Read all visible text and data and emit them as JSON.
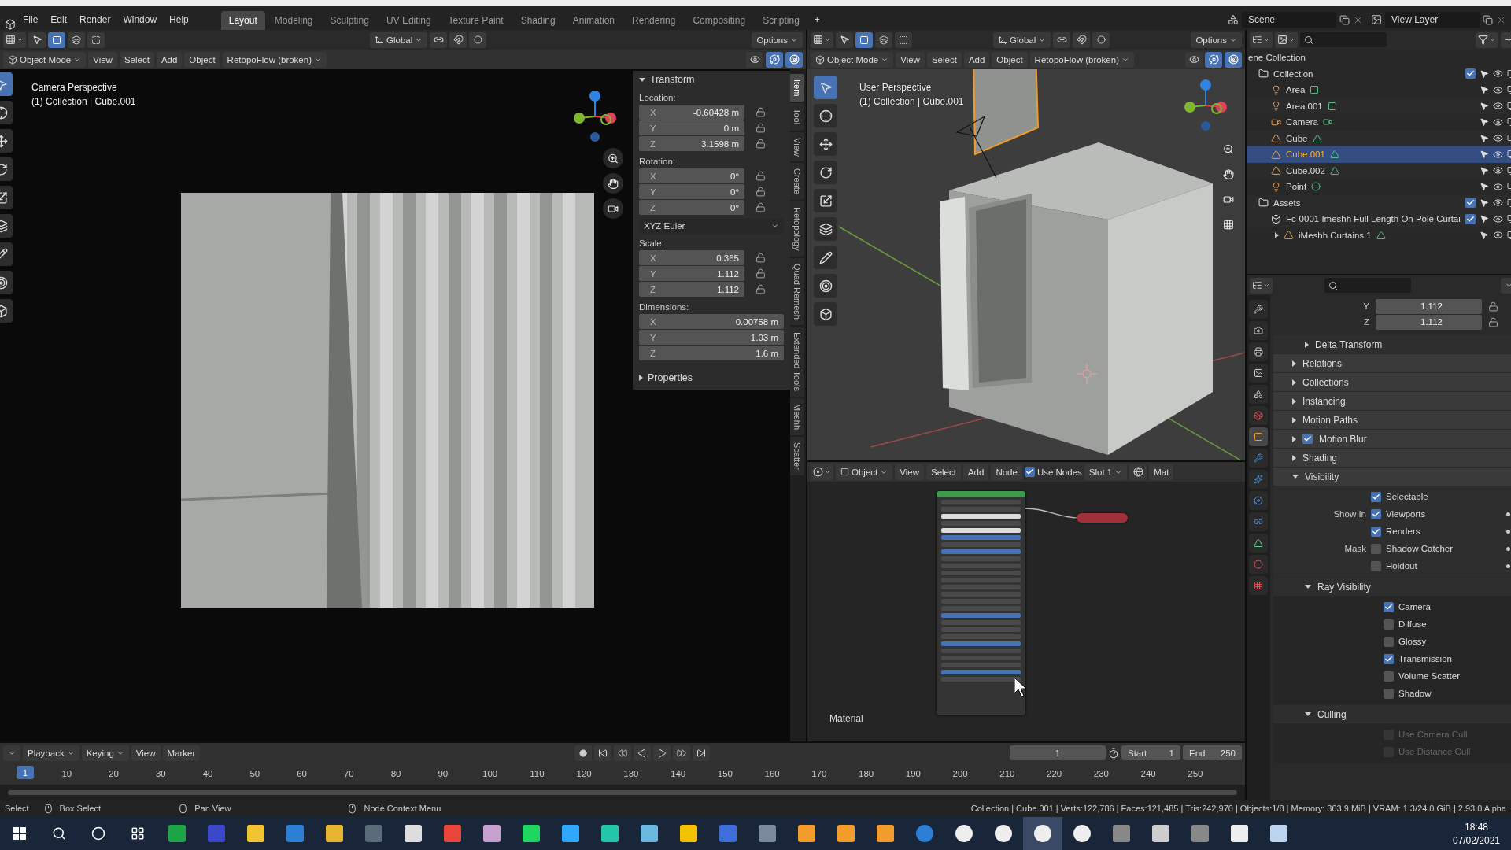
{
  "menu_bar": {
    "menus": [
      "File",
      "Edit",
      "Render",
      "Window",
      "Help"
    ],
    "workspaces": [
      {
        "label": "Layout",
        "selected": true
      },
      {
        "label": "Modeling",
        "selected": false
      },
      {
        "label": "Sculpting",
        "selected": false
      },
      {
        "label": "UV Editing",
        "selected": false
      },
      {
        "label": "Texture Paint",
        "selected": false
      },
      {
        "label": "Shading",
        "selected": false
      },
      {
        "label": "Animation",
        "selected": false
      },
      {
        "label": "Rendering",
        "selected": false
      },
      {
        "label": "Compositing",
        "selected": false
      },
      {
        "label": "Scripting",
        "selected": false
      }
    ],
    "add_workspace": "+",
    "scene": "Scene",
    "view_layer": "View Layer"
  },
  "camera_viewport": {
    "orientation": "Global",
    "options": "Options",
    "mode": "Object Mode",
    "menus": [
      "View",
      "Select",
      "Add",
      "Object"
    ],
    "addon_menu": "RetopoFlow (broken)",
    "overlay_lines": [
      "Camera Perspective",
      "(1) Collection | Cube.001"
    ],
    "sidebar": {
      "transform_title": "Transform",
      "groups": [
        {
          "label": "Location:",
          "fields": [
            {
              "axis": "X",
              "value": "-0.60428 m",
              "locked": false
            },
            {
              "axis": "Y",
              "value": "0 m",
              "locked": false
            },
            {
              "axis": "Z",
              "value": "3.1598 m",
              "locked": false
            }
          ]
        },
        {
          "label": "Rotation:",
          "fields": [
            {
              "axis": "X",
              "value": "0°",
              "locked": false
            },
            {
              "axis": "Y",
              "value": "0°",
              "locked": false
            },
            {
              "axis": "Z",
              "value": "0°",
              "locked": false
            }
          ],
          "mode": "XYZ Euler"
        },
        {
          "label": "Scale:",
          "fields": [
            {
              "axis": "X",
              "value": "0.365",
              "locked": false
            },
            {
              "axis": "Y",
              "value": "1.112",
              "locked": false
            },
            {
              "axis": "Z",
              "value": "1.112",
              "locked": false
            }
          ]
        },
        {
          "label": "Dimensions:",
          "fields": [
            {
              "axis": "X",
              "value": "0.00758 m"
            },
            {
              "axis": "Y",
              "value": "1.03 m"
            },
            {
              "axis": "Z",
              "value": "1.6 m"
            }
          ]
        }
      ],
      "properties_title": "Properties",
      "tabs": [
        {
          "label": "Item",
          "selected": true
        },
        {
          "label": "Tool",
          "selected": false
        },
        {
          "label": "View",
          "selected": false
        },
        {
          "label": "Create",
          "selected": false
        },
        {
          "label": "Retopology",
          "selected": false
        },
        {
          "label": "Quad Remesh",
          "selected": false
        },
        {
          "label": "Extended Tools",
          "selected": false
        },
        {
          "label": "Meshh",
          "selected": false
        },
        {
          "label": "Scatter",
          "selected": false
        }
      ]
    }
  },
  "user_viewport": {
    "orientation": "Global",
    "options": "Options",
    "mode": "Object Mode",
    "menus": [
      "View",
      "Select",
      "Add",
      "Object"
    ],
    "addon_menu": "RetopoFlow (broken)",
    "overlay_lines": [
      "User Perspective",
      "(1) Collection | Cube.001"
    ]
  },
  "node_editor": {
    "object_menu": "Object",
    "menus": [
      "View",
      "Select",
      "Add",
      "Node"
    ],
    "use_nodes": {
      "label": "Use Nodes",
      "checked": true
    },
    "slot": "Slot 1",
    "material_field": "Mat",
    "frame_label": "Material"
  },
  "timeline": {
    "menus": [
      "Playback",
      "Keying",
      "View",
      "Marker"
    ],
    "current_frame": "1",
    "start_label": "Start",
    "start": "1",
    "end_label": "End",
    "end": "250",
    "marker": "1",
    "ruler": [
      "10",
      "20",
      "30",
      "40",
      "50",
      "60",
      "70",
      "80",
      "90",
      "100",
      "110",
      "120",
      "130",
      "140",
      "150",
      "160",
      "170",
      "180",
      "190",
      "200",
      "210",
      "220",
      "230",
      "240",
      "250"
    ]
  },
  "outliner": {
    "root": "ene Collection",
    "items": [
      {
        "name": "Collection",
        "kind": "collection",
        "checked": true,
        "selected": false,
        "children": [
          {
            "name": "Area",
            "kind": "light",
            "selected": false
          },
          {
            "name": "Area.001",
            "kind": "light",
            "selected": false
          },
          {
            "name": "Camera",
            "kind": "camera",
            "selected": false
          },
          {
            "name": "Cube",
            "kind": "mesh",
            "selected": false
          },
          {
            "name": "Cube.001",
            "kind": "mesh",
            "selected": true
          },
          {
            "name": "Cube.002",
            "kind": "mesh",
            "selected": false
          },
          {
            "name": "Point",
            "kind": "point_light",
            "selected": false
          }
        ]
      },
      {
        "name": "Assets",
        "kind": "collection",
        "checked": true,
        "selected": false,
        "children": [
          {
            "name": "Fc-0001 Imeshh Full Length On Pole Curtai",
            "kind": "instance",
            "checked": true,
            "selected": false,
            "children": [
              {
                "name": "iMeshh Curtains 1",
                "kind": "mesh",
                "selected": false,
                "expanded": false
              }
            ]
          }
        ]
      }
    ]
  },
  "properties": {
    "tabs": [
      {
        "kind": "tool",
        "selected": false
      },
      {
        "kind": "render",
        "selected": false
      },
      {
        "kind": "output",
        "selected": false
      },
      {
        "kind": "view_layer",
        "selected": false
      },
      {
        "kind": "scene",
        "selected": false
      },
      {
        "kind": "world",
        "selected": false
      },
      {
        "kind": "object",
        "selected": true
      },
      {
        "kind": "modifier",
        "selected": false
      },
      {
        "kind": "particles",
        "selected": false
      },
      {
        "kind": "physics",
        "selected": false
      },
      {
        "kind": "constraint",
        "selected": false
      },
      {
        "kind": "data",
        "selected": false
      },
      {
        "kind": "material",
        "selected": false
      },
      {
        "kind": "texture",
        "selected": false
      }
    ],
    "transform_rows": [
      {
        "axis": "Y",
        "value": "1.112",
        "locked": false
      },
      {
        "axis": "Z",
        "value": "1.112",
        "locked": false
      }
    ],
    "panels": [
      {
        "label": "Delta Transform",
        "kind": "subpanel",
        "expanded": false
      },
      {
        "label": "Relations",
        "kind": "panel",
        "expanded": false
      },
      {
        "label": "Collections",
        "kind": "panel",
        "expanded": false
      },
      {
        "label": "Instancing",
        "kind": "panel",
        "expanded": false
      },
      {
        "label": "Motion Paths",
        "kind": "panel",
        "expanded": false
      },
      {
        "label": "Motion Blur",
        "kind": "panel",
        "expanded": false,
        "checked": true
      },
      {
        "label": "Shading",
        "kind": "panel",
        "expanded": false
      },
      {
        "label": "Visibility",
        "kind": "panel",
        "expanded": true,
        "rows": [
          {
            "label": "Selectable",
            "checked": true,
            "decorator": false
          },
          {
            "heading": "Show In",
            "label": "Viewports",
            "checked": true,
            "decorator": true
          },
          {
            "label": "Renders",
            "checked": true,
            "decorator": true
          },
          {
            "heading": "Mask",
            "label": "Shadow Catcher",
            "checked": false,
            "decorator": true
          },
          {
            "label": "Holdout",
            "checked": false,
            "decorator": true
          }
        ],
        "subpanels": [
          {
            "label": "Ray Visibility",
            "expanded": true,
            "rows": [
              {
                "label": "Camera",
                "checked": true,
                "disabled": false
              },
              {
                "label": "Diffuse",
                "checked": false,
                "disabled": false
              },
              {
                "label": "Glossy",
                "checked": false,
                "disabled": false
              },
              {
                "label": "Transmission",
                "checked": true,
                "disabled": false
              },
              {
                "label": "Volume Scatter",
                "checked": false,
                "disabled": false
              },
              {
                "label": "Shadow",
                "checked": false,
                "disabled": false
              }
            ]
          },
          {
            "label": "Culling",
            "expanded": true,
            "rows": [
              {
                "label": "Use Camera Cull",
                "checked": false,
                "disabled": true
              },
              {
                "label": "Use Distance Cull",
                "checked": false,
                "disabled": true
              }
            ]
          }
        ]
      }
    ]
  },
  "status_bar": {
    "hints": [
      "Select",
      "Box Select",
      "Pan View",
      "Node Context Menu"
    ],
    "stats": "Collection | Cube.001 | Verts:122,786 | Faces:121,485 | Tris:242,970 | Objects:1/8 | Memory: 303.9 MiB | VRAM: 1.3/24.0 GiB | 2.93.0 Alpha"
  },
  "taskbar": {
    "time": "18:48",
    "date": "07/02/2021"
  }
}
